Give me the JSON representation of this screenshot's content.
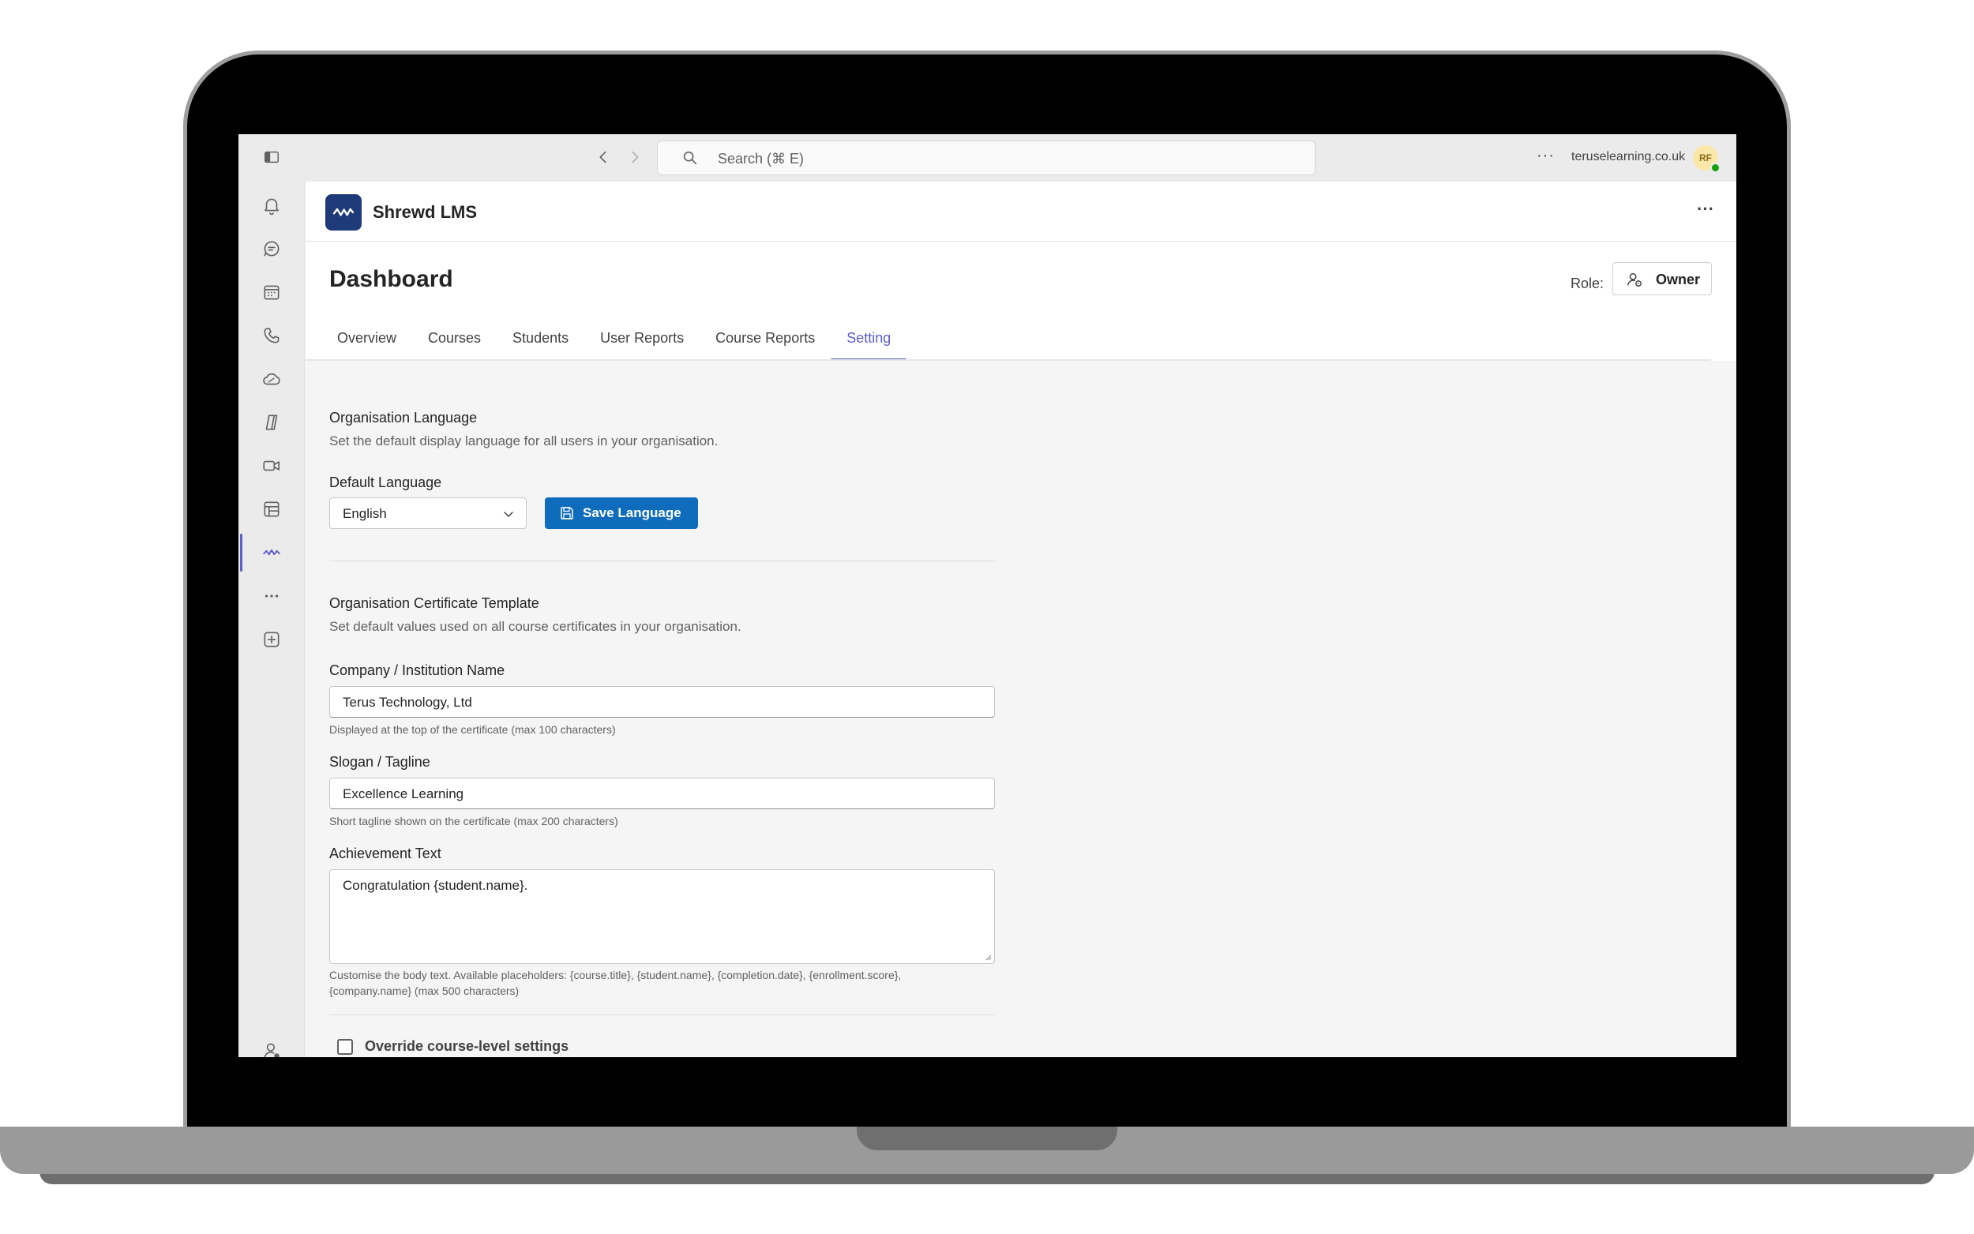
{
  "titlebar": {
    "search_placeholder": "Search (⌘ E)",
    "domain": "teruselearning.co.uk",
    "avatar_initials": "RF"
  },
  "rail": {
    "items": [
      "activity",
      "chat",
      "calendar",
      "calls",
      "onedrive",
      "copilot",
      "meet",
      "planner",
      "shrewd-lms",
      "more-apps",
      "add-app"
    ],
    "active": "shrewd-lms"
  },
  "app": {
    "name": "Shrewd LMS",
    "brand_color": "#1e3a78"
  },
  "dashboard": {
    "title": "Dashboard",
    "role_label": "Role:",
    "role_value": "Owner",
    "tabs": [
      {
        "label": "Overview"
      },
      {
        "label": "Courses"
      },
      {
        "label": "Students"
      },
      {
        "label": "User Reports"
      },
      {
        "label": "Course Reports"
      },
      {
        "label": "Setting"
      }
    ],
    "active_tab": "Setting"
  },
  "language": {
    "title": "Organisation Language",
    "description": "Set the default display language for all users in your organisation.",
    "field_label": "Default Language",
    "selected": "English",
    "save_label": "Save Language"
  },
  "certificate": {
    "title": "Organisation Certificate Template",
    "description": "Set default values used on all course certificates in your organisation.",
    "company_label": "Company / Institution Name",
    "company_value": "Terus Technology, Ltd",
    "company_help": "Displayed at the top of the certificate (max 100 characters)",
    "slogan_label": "Slogan / Tagline",
    "slogan_value": "Excellence Learning",
    "slogan_help": "Short tagline shown on the certificate (max 200 characters)",
    "achievement_label": "Achievement Text",
    "achievement_value": "Congratulation {student.name}.",
    "achievement_help_1": "Customise the body text. Available placeholders: {course.title}, {student.name}, {completion.date}, {enrollment.score},",
    "achievement_help_2": "{company.name} (max 500 characters)",
    "override_label": "Override course-level settings",
    "override_checked": false
  },
  "colors": {
    "accent": "#5b5fc7",
    "primary_button": "#0f6cbd",
    "presence": "#13a10e"
  }
}
